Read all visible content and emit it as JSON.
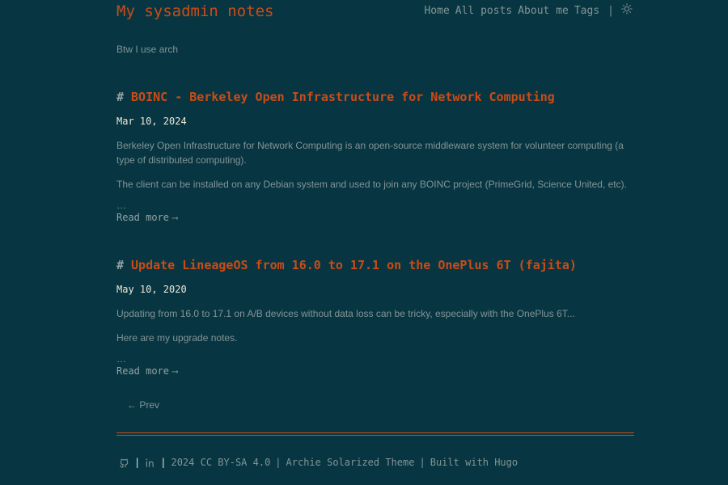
{
  "site": {
    "title": "My sysadmin notes",
    "tagline": "Btw I use arch"
  },
  "nav": {
    "items": [
      "Home",
      "All posts",
      "About me",
      "Tags"
    ],
    "separator": "|",
    "theme_toggle_icon": "sun-icon"
  },
  "posts": [
    {
      "hash": "#",
      "title": "BOINC - Berkeley Open Infrastructure for Network Computing",
      "date": "Mar 10, 2024",
      "paragraphs": [
        "Berkeley Open Infrastructure for Network Computing is an open-source middleware system for volunteer computing (a type of distributed computing).",
        "The client can be installed on any Debian system and used to join any BOINC project (PrimeGrid, Science United, etc)."
      ],
      "ellipsis": "…",
      "read_more": "Read more",
      "read_more_arrow": "⟶"
    },
    {
      "hash": "#",
      "title": "Update LineageOS from 16.0 to 17.1 on the OnePlus 6T (fajita)",
      "date": "May 10, 2020",
      "paragraphs": [
        "Updating from 16.0 to 17.1 on A/B devices without data loss can be tricky, especially with the OnePlus 6T...",
        "Here are my upgrade notes."
      ],
      "ellipsis": "…",
      "read_more": "Read more",
      "read_more_arrow": "⟶"
    }
  ],
  "pagination": {
    "prev": "← Prev"
  },
  "footer": {
    "github_icon": "github-icon",
    "linkedin_icon": "linkedin-icon",
    "separator": "|",
    "copyright": "2024 CC BY-SA 4.0",
    "theme": "Archie Solarized Theme",
    "built_with": "Built with Hugo"
  },
  "colors": {
    "background": "#073642",
    "accent": "#cb4b16",
    "text": "#839496",
    "emphasis": "#eee8d5"
  }
}
